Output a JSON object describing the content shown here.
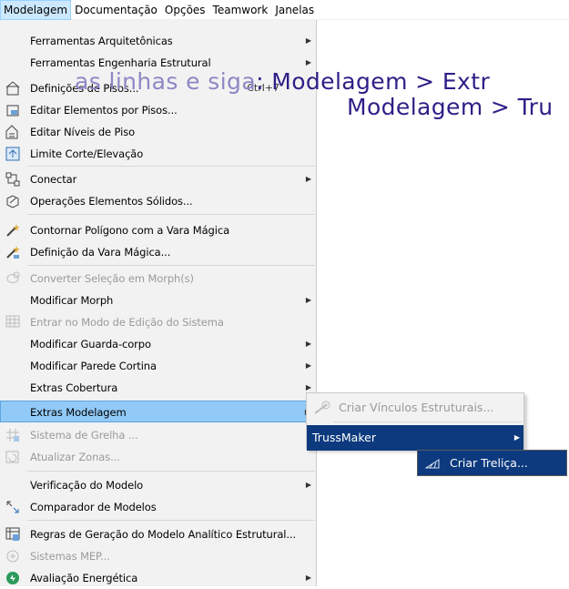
{
  "menubar": {
    "items": [
      "Modelagem",
      "Documentação",
      "Opções",
      "Teamwork",
      "Janelas"
    ]
  },
  "menu": {
    "items": [
      {
        "label": "Ferramentas Arquitetônicas",
        "submenu": true
      },
      {
        "label": "Ferramentas Engenharia Estrutural",
        "submenu": true
      },
      {
        "label": "Definições de Pisos...",
        "shortcut": "Ctrl+7",
        "icon": "stories-icon"
      },
      {
        "label": "Editar Elementos por Pisos...",
        "icon": "edit-stories-icon"
      },
      {
        "label": "Editar Níveis de Piso",
        "icon": "floor-levels-icon"
      },
      {
        "label": "Limite Corte/Elevação",
        "icon": "cut-limit-icon"
      },
      {
        "label": "Conectar",
        "submenu": true,
        "icon": "connect-icon"
      },
      {
        "label": "Operações Elementos Sólidos...",
        "icon": "solid-ops-icon"
      },
      {
        "label": "Contornar Polígono com a Vara Mágica",
        "icon": "magic-wand-icon"
      },
      {
        "label": "Definição da Vara Mágica...",
        "icon": "magic-wand-settings-icon"
      },
      {
        "label": "Converter Seleção em Morph(s)",
        "disabled": true,
        "icon": "morph-icon"
      },
      {
        "label": "Modificar Morph",
        "submenu": true
      },
      {
        "label": "Entrar no Modo de Edição do Sistema",
        "disabled": true,
        "icon": "system-edit-icon"
      },
      {
        "label": "Modificar Guarda-corpo",
        "submenu": true
      },
      {
        "label": "Modificar Parede Cortina",
        "submenu": true
      },
      {
        "label": "Extras Cobertura",
        "submenu": true
      },
      {
        "label": "Extras Modelagem",
        "submenu": true,
        "highlighted": true
      },
      {
        "label": "Sistema de Grelha ...",
        "disabled": true,
        "icon": "grid-system-icon"
      },
      {
        "label": "Atualizar Zonas...",
        "disabled": true,
        "icon": "update-zones-icon"
      },
      {
        "label": "Verificação do Modelo",
        "submenu": true
      },
      {
        "label": "Comparador de Modelos",
        "icon": "compare-icon"
      },
      {
        "label": "Regras de Geração do Modelo Analítico Estrutural...",
        "icon": "analytical-rules-icon"
      },
      {
        "label": "Sistemas MEP...",
        "disabled": true,
        "icon": "mep-icon"
      },
      {
        "label": "Avaliação Energética",
        "submenu": true,
        "icon": "energy-icon"
      }
    ]
  },
  "submenu": {
    "items": [
      {
        "label": "Criar Vínculos Estruturais...",
        "disabled": true,
        "icon": "structural-links-icon"
      },
      {
        "label": "TrussMaker",
        "highlighted": true,
        "submenu": true
      }
    ]
  },
  "submenu2": {
    "items": [
      {
        "label": "Criar Treliça...",
        "icon": "truss-icon"
      }
    ]
  },
  "overlay": {
    "line1_prefix": "as linhas e siga",
    "line1_path": ": Modelagem  > Extr",
    "line2": "Modelagem > Tru"
  },
  "colors": {
    "highlight": "#91c9f7",
    "selected_dark": "#0d3a7e",
    "overlay_text": "#2d1f86"
  }
}
